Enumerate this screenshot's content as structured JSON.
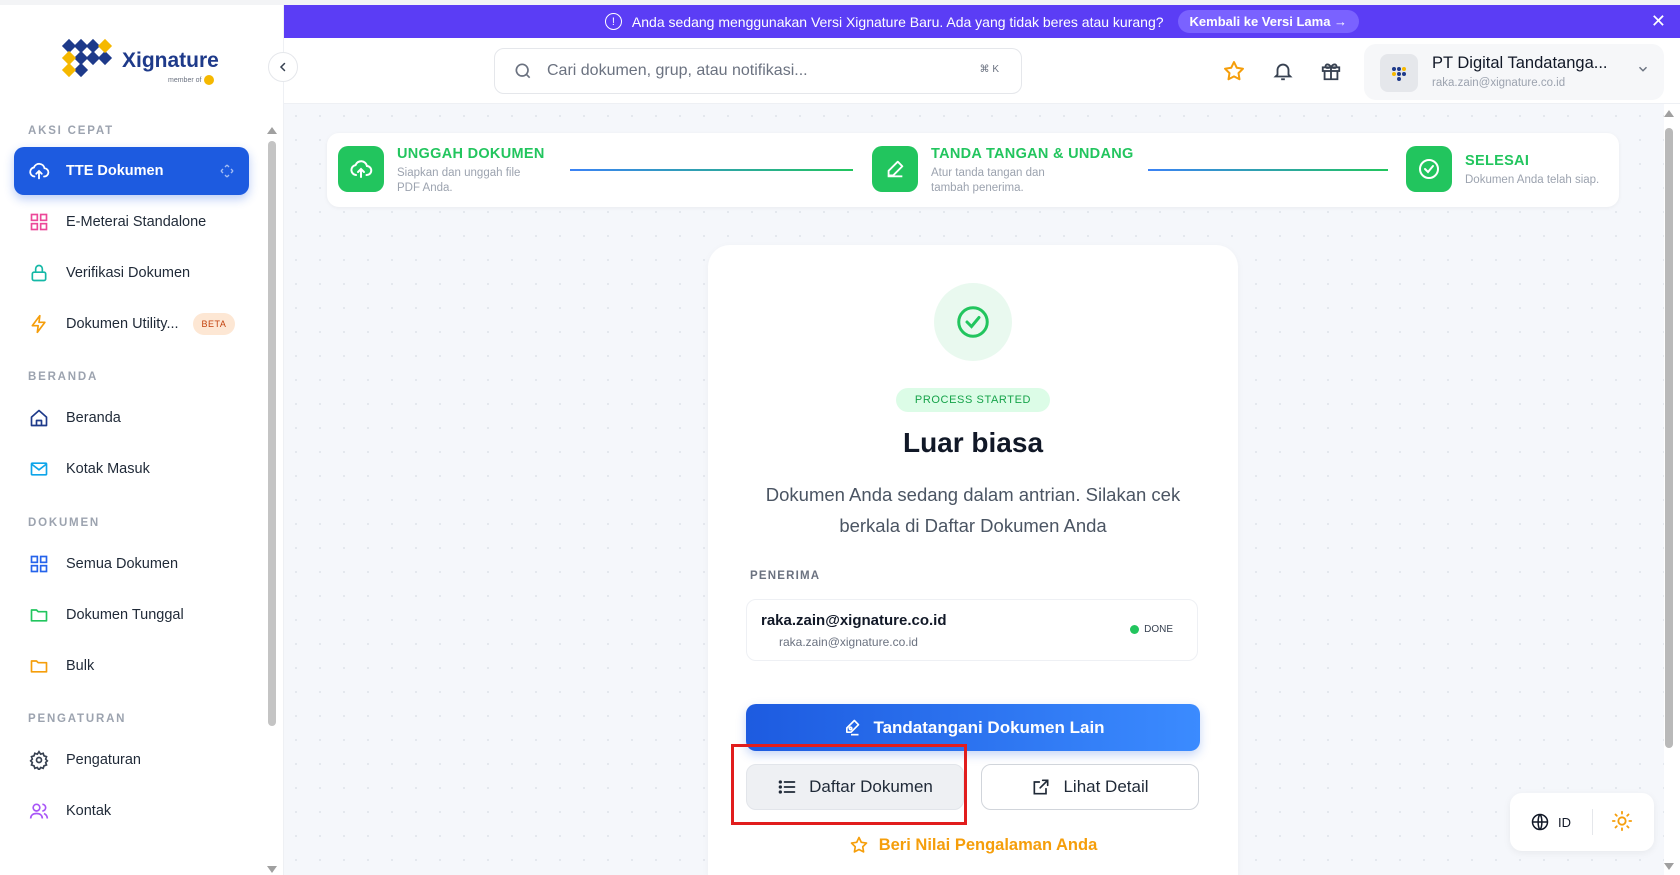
{
  "brand": {
    "name": "Xignature",
    "sub": "member of"
  },
  "banner": {
    "message": "Anda sedang menggunakan Versi Xignature Baru. Ada yang tidak beres atau kurang?",
    "back_label": "Kembali ke Versi Lama →",
    "close": "✕"
  },
  "search": {
    "placeholder": "Cari dokumen, grup, atau notifikasi...",
    "shortcut": "⌘ K"
  },
  "profile": {
    "name": "PT Digital Tandatanga...",
    "email": "raka.zain@xignature.co.id"
  },
  "sidebar": {
    "sections": {
      "quick": "AKSI CEPAT",
      "home": "BERANDA",
      "docs": "DOKUMEN",
      "settings": "PENGATURAN"
    },
    "items": [
      {
        "label": "TTE Dokumen",
        "icon": "upload-cloud-icon"
      },
      {
        "label": "E-Meterai Standalone",
        "icon": "grid-icon"
      },
      {
        "label": "Verifikasi Dokumen",
        "icon": "lock-icon"
      },
      {
        "label": "Dokumen Utility...",
        "icon": "bolt-icon",
        "badge": "BETA"
      },
      {
        "label": "Beranda",
        "icon": "home-icon"
      },
      {
        "label": "Kotak Masuk",
        "icon": "mail-icon"
      },
      {
        "label": "Semua Dokumen",
        "icon": "grid-icon"
      },
      {
        "label": "Dokumen Tunggal",
        "icon": "folder-icon"
      },
      {
        "label": "Bulk",
        "icon": "folder-icon"
      },
      {
        "label": "Pengaturan",
        "icon": "gear-icon"
      },
      {
        "label": "Kontak",
        "icon": "users-icon"
      }
    ]
  },
  "stepper": [
    {
      "title": "UNGGAH DOKUMEN",
      "desc1": "Siapkan dan unggah file",
      "desc2": "PDF Anda."
    },
    {
      "title": "TANDA TANGAN & UNDANG",
      "desc1": "Atur tanda tangan dan",
      "desc2": "tambah penerima."
    },
    {
      "title": "SELESAI",
      "desc1": "Dokumen Anda telah siap.",
      "desc2": ""
    }
  ],
  "card": {
    "badge": "PROCESS STARTED",
    "title": "Luar biasa",
    "desc": "Dokumen Anda sedang dalam antrian. Silakan cek berkala di Daftar Dokumen Anda",
    "recipients_label": "PENERIMA",
    "recipient": {
      "name": "raka.zain@xignature.co.id",
      "email": "raka.zain@xignature.co.id",
      "status": "DONE"
    },
    "primary_button": "Tandatangani Dokumen Lain",
    "list_button": "Daftar Dokumen",
    "detail_button": "Lihat Detail",
    "rate_link": "Beri Nilai Pengalaman Anda"
  },
  "locale": {
    "lang": "ID"
  },
  "colors": {
    "primary": "#1d5be0",
    "success": "#22c55e",
    "banner": "#5b3df5",
    "accent": "#f59e0b",
    "highlight": "#e11d1d"
  }
}
